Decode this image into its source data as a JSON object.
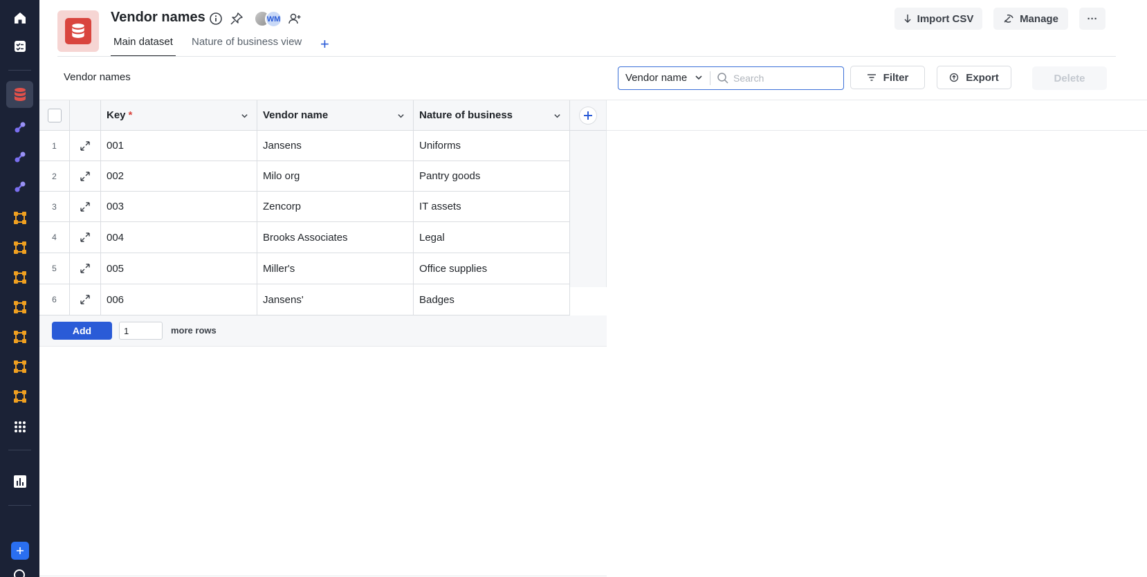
{
  "sidebar": {
    "icons": [
      {
        "name": "home-icon",
        "color": "#ffffff"
      },
      {
        "name": "tasks-icon",
        "color": "#ffffff"
      },
      {
        "name": "database-icon",
        "color": "#e0504a",
        "active": true
      },
      {
        "name": "integration-icon",
        "color": "#7a6ff0"
      },
      {
        "name": "integration-icon",
        "color": "#7a6ff0"
      },
      {
        "name": "integration-icon",
        "color": "#7a6ff0"
      },
      {
        "name": "workflow-icon",
        "color": "#f0a020"
      },
      {
        "name": "workflow-icon",
        "color": "#f0a020"
      },
      {
        "name": "workflow-icon",
        "color": "#f0a020"
      },
      {
        "name": "workflow-icon",
        "color": "#f0a020"
      },
      {
        "name": "workflow-icon",
        "color": "#f0a020"
      },
      {
        "name": "workflow-icon",
        "color": "#f0a020"
      },
      {
        "name": "workflow-icon",
        "color": "#f0a020"
      },
      {
        "name": "apps-grid-icon",
        "color": "#ffffff"
      },
      {
        "name": "chart-icon",
        "color": "#ffffff"
      },
      {
        "name": "add-icon",
        "color": "#2a6ff0"
      }
    ]
  },
  "header": {
    "title": "Vendor names",
    "avatar_initials": "WM",
    "tabs": [
      {
        "label": "Main dataset",
        "active": true
      },
      {
        "label": "Nature of business view",
        "active": false
      }
    ],
    "add_tab_label": "+",
    "import_label": "Import CSV",
    "manage_label": "Manage",
    "more_label": "···"
  },
  "toolbar": {
    "section_label": "Vendor names",
    "search_field": "Vendor name",
    "search_placeholder": "Search",
    "filter_label": "Filter",
    "export_label": "Export",
    "delete_label": "Delete"
  },
  "table": {
    "columns": [
      {
        "label": "Key",
        "required_mark": "*"
      },
      {
        "label": "Vendor name"
      },
      {
        "label": "Nature of business"
      }
    ],
    "rows": [
      {
        "num": "1",
        "key": "001",
        "vendor": "Jansens",
        "business": "Uniforms"
      },
      {
        "num": "2",
        "key": "002",
        "vendor": "Milo org",
        "business": "Pantry goods"
      },
      {
        "num": "3",
        "key": "003",
        "vendor": "Zencorp",
        "business": "IT assets"
      },
      {
        "num": "4",
        "key": "004",
        "vendor": "Brooks Associates",
        "business": "Legal"
      },
      {
        "num": "5",
        "key": "005",
        "vendor": "Miller's",
        "business": "Office supplies"
      },
      {
        "num": "6",
        "key": "006",
        "vendor": "Jansens'",
        "business": "Badges"
      }
    ],
    "footer": {
      "add_label": "Add",
      "rows_value": "1",
      "more_rows_label": "more rows"
    }
  },
  "colors": {
    "accent": "#2a5bd7",
    "sidebar_bg": "#1b2236",
    "database_red": "#d9453e"
  }
}
